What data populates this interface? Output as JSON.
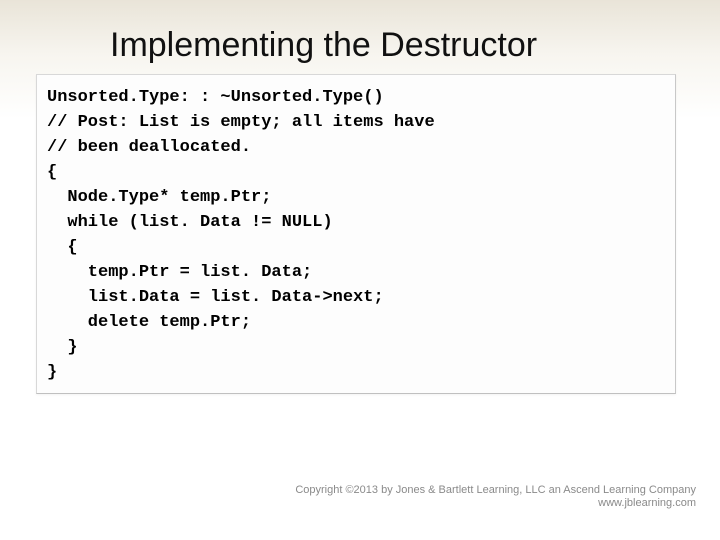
{
  "title": "Implementing the Destructor",
  "code_lines": [
    "Unsorted.Type: : ~Unsorted.Type()",
    "// Post: List is empty; all items have",
    "// been deallocated.",
    "{",
    "  Node.Type* temp.Ptr;",
    "  while (list. Data != NULL)",
    "  {",
    "    temp.Ptr = list. Data;",
    "    list.Data = list. Data->next;",
    "    delete temp.Ptr;",
    "  }",
    "}"
  ],
  "copyright": {
    "line1": "Copyright ©2013 by Jones & Bartlett Learning, LLC an Ascend Learning Company",
    "line2": "www.jblearning.com"
  }
}
